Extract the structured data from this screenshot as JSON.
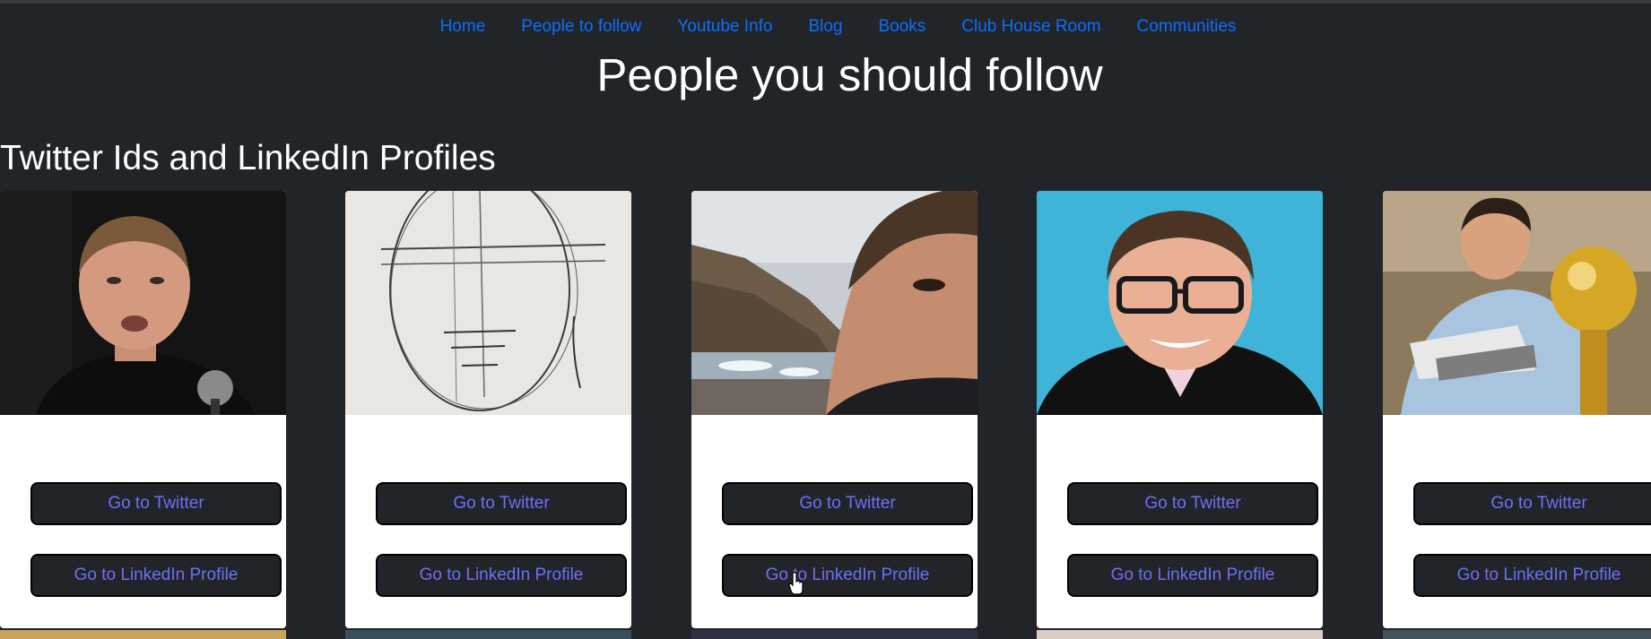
{
  "nav": {
    "items": [
      {
        "label": "Home"
      },
      {
        "label": "People to follow"
      },
      {
        "label": "Youtube Info"
      },
      {
        "label": "Blog"
      },
      {
        "label": "Books"
      },
      {
        "label": "Club House Room"
      },
      {
        "label": "Communities"
      }
    ]
  },
  "page": {
    "title": "People you should follow",
    "section_title": "Twitter Ids and LinkedIn Profiles"
  },
  "cards": [
    {
      "twitter_label": "Go to Twitter",
      "linkedin_label": "Go to LinkedIn Profile"
    },
    {
      "twitter_label": "Go to Twitter",
      "linkedin_label": "Go to LinkedIn Profile"
    },
    {
      "twitter_label": "Go to Twitter",
      "linkedin_label": "Go to LinkedIn Profile"
    },
    {
      "twitter_label": "Go to Twitter",
      "linkedin_label": "Go to LinkedIn Profile"
    },
    {
      "twitter_label": "Go to Twitter",
      "linkedin_label": "Go to LinkedIn Profile"
    }
  ],
  "colors": {
    "background": "#212529",
    "nav_link": "#0d6efd",
    "button_text": "#6f6ff5",
    "card": "#ffffff"
  }
}
